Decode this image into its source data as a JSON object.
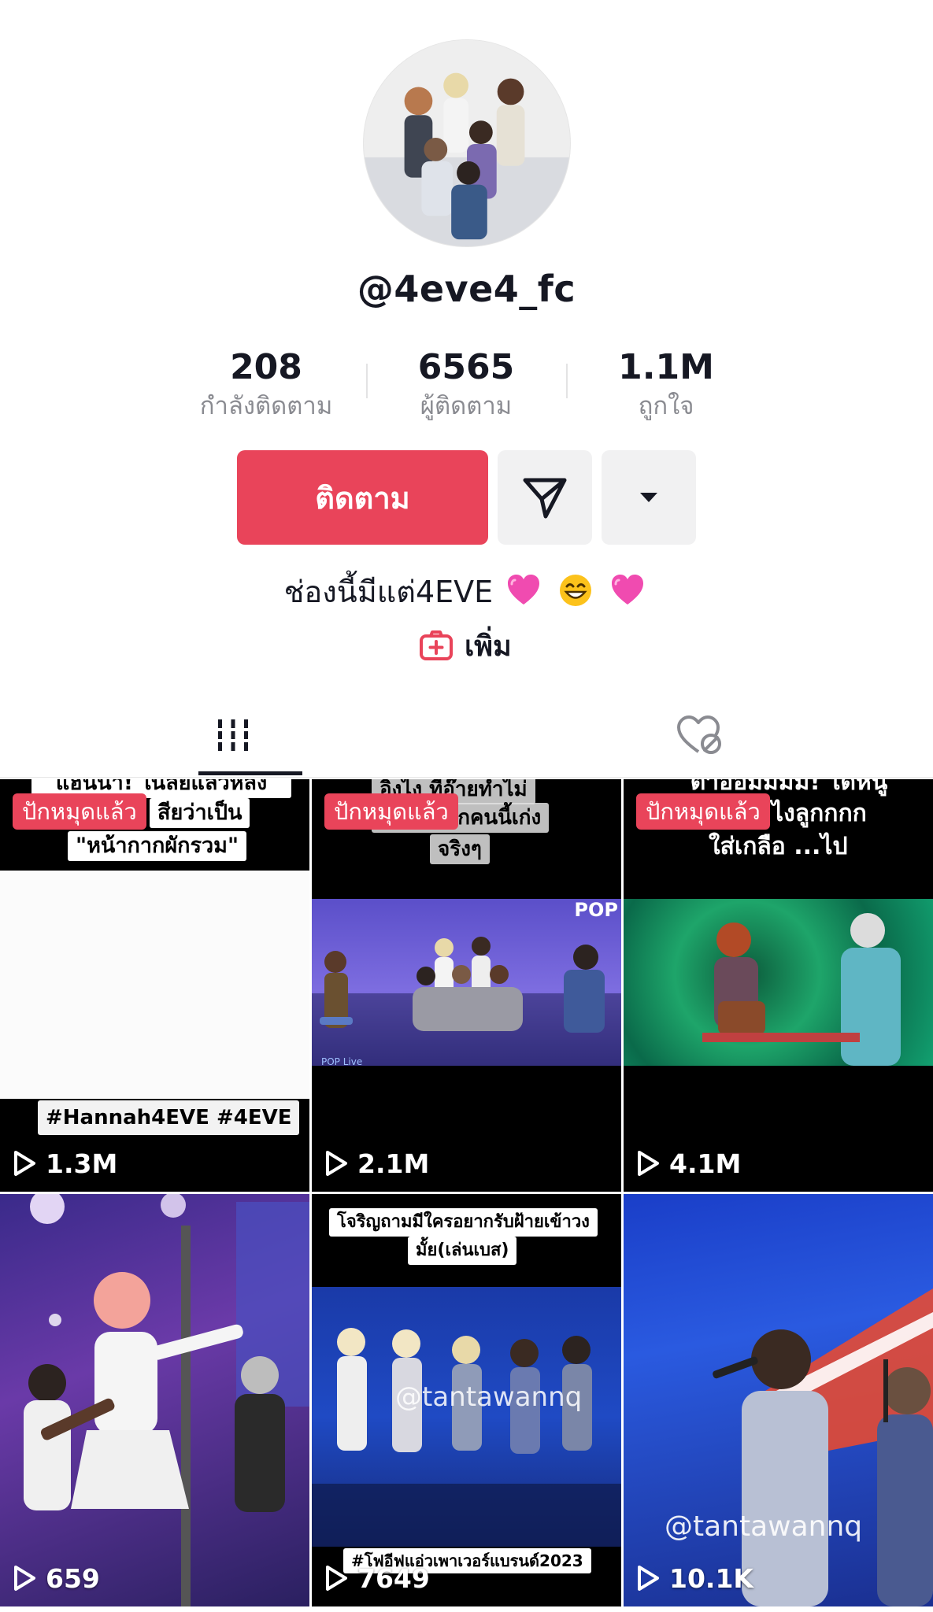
{
  "profile": {
    "username": "@4eve4_fc",
    "stats": [
      {
        "value": "208",
        "label": "กำลังติดตาม"
      },
      {
        "value": "6565",
        "label": "ผู้ติดตาม"
      },
      {
        "value": "1.1M",
        "label": "ถูกใจ"
      }
    ],
    "follow_label": "ติดตาม",
    "bio": "ช่องนี้มีแต่4EVE",
    "add_label": "เพิ่ม"
  },
  "tabs": [
    {
      "icon": "grid-icon",
      "active": true
    },
    {
      "icon": "liked-hidden-icon",
      "active": false
    }
  ],
  "videos": [
    {
      "pinned_label": "ปักหมุดแล้ว",
      "views": "1.3M",
      "captions": [
        "แฮนนา! ในลัยแล้วหลัง",
        "สียว่าเป็น",
        "\"หน้ากากผักรวม\"",
        "#Hannah4EVE #4EVE"
      ]
    },
    {
      "pinned_label": "ปักหมุดแล้ว",
      "views": "2.1M",
      "captions": [
        "อิงไง ที่อ๊ายทำไม่",
        "ได้ งง เด็กคนนี้เก่ง",
        "จริงๆ",
        "POP",
        "POP Live"
      ]
    },
    {
      "pinned_label": "ปักหมุดแล้ว",
      "views": "4.1M",
      "captions": [
        "ตาอ๋อมมมม! ได้หนู",
        "ไงลูกกกก",
        "ใส่เกลือ ...ไป"
      ]
    },
    {
      "pinned_label": "",
      "views": "659",
      "captions": []
    },
    {
      "pinned_label": "",
      "views": "7649",
      "captions": [
        "โจริญถามมีใครอยากรับฝ้ายเข้าวง",
        "มั้ย(เล่นเบส)",
        "@tantawannq",
        "#โฟอีฟแอ่วเพาเวอร์แบรนด์2023"
      ]
    },
    {
      "pinned_label": "",
      "views": "10.1K",
      "captions": [
        "@tantawannq"
      ]
    }
  ],
  "colors": {
    "accent": "#e9445a",
    "text": "#161823",
    "muted": "#8a8b91"
  }
}
